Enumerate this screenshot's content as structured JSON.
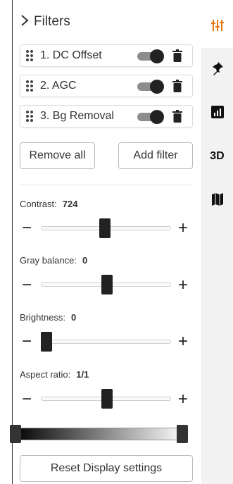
{
  "header": {
    "title": "Filters"
  },
  "filters": [
    {
      "label": "1. DC Offset",
      "enabled": true
    },
    {
      "label": "2. AGC",
      "enabled": true
    },
    {
      "label": "3. Bg Removal",
      "enabled": true
    }
  ],
  "actions": {
    "remove_all": "Remove all",
    "add_filter": "Add filter"
  },
  "sliders": [
    {
      "label": "Contrast:",
      "value": "724",
      "position": 0.49
    },
    {
      "label": "Gray balance:",
      "value": "0",
      "position": 0.51
    },
    {
      "label": "Brightness:",
      "value": "0",
      "position": 0.0
    },
    {
      "label": "Aspect ratio:",
      "value": "1/1",
      "position": 0.51
    }
  ],
  "slider_controls": {
    "minus": "−",
    "plus": "+"
  },
  "gradient": {
    "low": 0.0,
    "high": 1.0
  },
  "reset_label": "Reset Display settings",
  "rail": {
    "text_tab": "3D",
    "icons": [
      "sliders-icon",
      "pin-icon",
      "chart-icon",
      "3d-tab",
      "map-icon"
    ]
  },
  "colors": {
    "accent": "#e8750f"
  }
}
